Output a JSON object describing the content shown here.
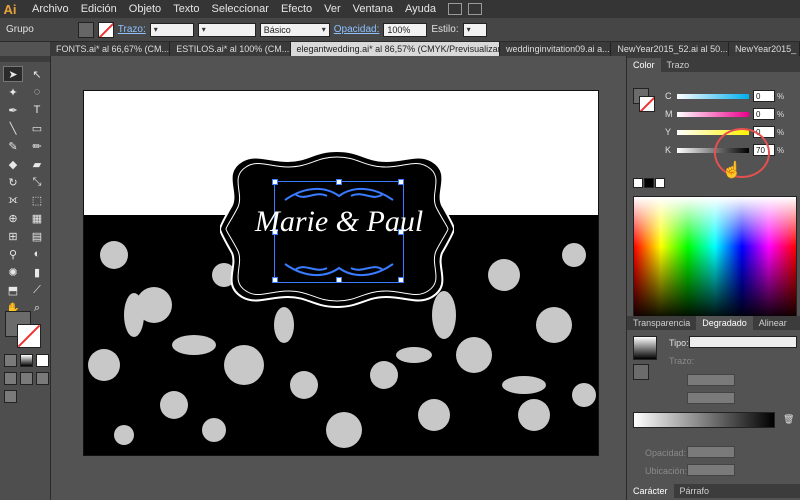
{
  "app": {
    "logo": "Ai"
  },
  "menu": [
    "Archivo",
    "Edición",
    "Objeto",
    "Texto",
    "Seleccionar",
    "Efecto",
    "Ver",
    "Ventana",
    "Ayuda"
  ],
  "control": {
    "group": "Grupo",
    "trazo": "Trazo:",
    "brush": "Básico",
    "opacity_label": "Opacidad:",
    "opacity_value": "100%",
    "style": "Estilo:"
  },
  "tabs": [
    "FONTS.ai* al 66,67% (CM...",
    "ESTILOS.ai* al 100% (CM...",
    "elegantwedding.ai* al 86,57% (CMYK/Previsualizar)",
    "weddinginvitation09.ai a...",
    "NewYear2015_52.ai al 50...",
    "NewYear2015_"
  ],
  "artboard": {
    "title": "Marie & Paul"
  },
  "color_panel": {
    "tabs": [
      "Color",
      "Trazo"
    ],
    "rows": [
      {
        "label": "C",
        "value": "0",
        "unit": "%"
      },
      {
        "label": "M",
        "value": "0",
        "unit": "%"
      },
      {
        "label": "Y",
        "value": "0",
        "unit": "%"
      },
      {
        "label": "K",
        "value": "70",
        "unit": "%"
      }
    ]
  },
  "gradient_panel": {
    "tabs": [
      "Transparencia",
      "Degradado",
      "Alinear"
    ],
    "tipo": "Tipo:",
    "trazo": "Trazo:",
    "opacidad": "Opacidad:",
    "ubicacion": "Ubicación:"
  },
  "char_panel": {
    "tabs": [
      "Carácter",
      "Párrafo"
    ]
  },
  "colors": {
    "accent": "#3a7bff",
    "annotation": "#e45050"
  }
}
